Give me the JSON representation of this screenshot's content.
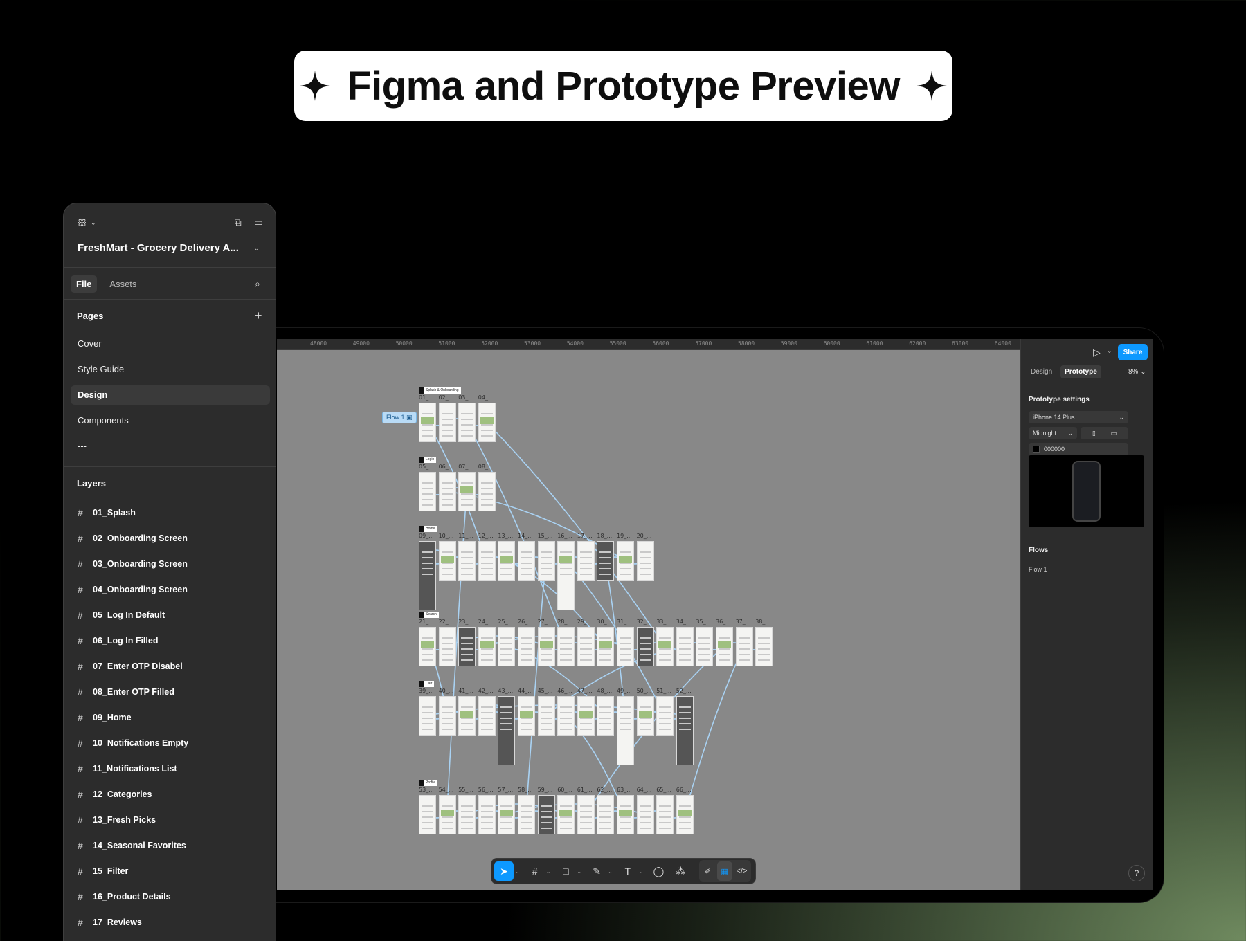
{
  "header": {
    "title": "Figma and Prototype Preview"
  },
  "left_panel": {
    "project_name": "FreshMart - Grocery Delivery A...",
    "tabs": [
      "File",
      "Assets"
    ],
    "pages_heading": "Pages",
    "pages": [
      "Cover",
      "Style Guide",
      "Design",
      "Components",
      "---"
    ],
    "active_page": "Design",
    "layers_heading": "Layers",
    "layers": [
      "01_Splash",
      "02_Onboarding Screen",
      "03_Onboarding Screen",
      "04_Onboarding Screen",
      "05_Log In Default",
      "06_Log In Filled",
      "07_Enter OTP Disabel",
      "08_Enter OTP Filled",
      "09_Home",
      "10_Notifications Empty",
      "11_Notifications List",
      "12_Categories",
      "13_Fresh Picks",
      "14_Seasonal Favorites",
      "15_Filter",
      "16_Product Details",
      "17_Reviews"
    ]
  },
  "ruler": {
    "ticks": [
      "48000",
      "49000",
      "50000",
      "51000",
      "52000",
      "53000",
      "54000",
      "55000",
      "56000",
      "57000",
      "58000",
      "59000",
      "60000",
      "61000",
      "62000",
      "63000",
      "64000"
    ]
  },
  "canvas": {
    "flow_tag": "Flow 1",
    "rows": [
      {
        "tag": "Splash & Onboarding",
        "labels": [
          "01_...",
          "02_...",
          "03_...",
          "04_..."
        ]
      },
      {
        "tag": "Login",
        "labels": [
          "05_...",
          "06_...",
          "07_...",
          "08_..."
        ]
      },
      {
        "tag": "Home",
        "labels": [
          "09_...",
          "10_...",
          "11_...",
          "12_...",
          "13_...",
          "14_...",
          "15_...",
          "16_...",
          "17_...",
          "18_...",
          "19_...",
          "20_..."
        ]
      },
      {
        "tag": "Search",
        "labels": [
          "21_...",
          "22_...",
          "23_...",
          "24_...",
          "25_...",
          "26_...",
          "27_...",
          "28_...",
          "29_...",
          "30_...",
          "31_...",
          "32_...",
          "33_...",
          "34_...",
          "35_...",
          "36_...",
          "37_...",
          "38_..."
        ]
      },
      {
        "tag": "Cart",
        "labels": [
          "39_...",
          "40_...",
          "41_...",
          "42_...",
          "43_...",
          "44_...",
          "45_...",
          "46_...",
          "47_...",
          "48_...",
          "49_...",
          "50_...",
          "51_...",
          "52_..."
        ]
      },
      {
        "tag": "Profile",
        "labels": [
          "53_...",
          "54_...",
          "55_...",
          "56_...",
          "57_...",
          "58_...",
          "59_...",
          "60_...",
          "61_...",
          "62_...",
          "63_...",
          "64_...",
          "65_...",
          "66_..."
        ]
      }
    ]
  },
  "right_panel": {
    "share_label": "Share",
    "tabs": [
      "Design",
      "Prototype"
    ],
    "active_tab": "Prototype",
    "zoom": "8%",
    "prototype_settings_heading": "Prototype settings",
    "device": "iPhone 14 Plus",
    "device_color": "Midnight",
    "background_color": "000000",
    "flows_heading": "Flows",
    "flows": [
      "Flow 1"
    ],
    "help": "?"
  },
  "colors": {
    "accent": "#0d99ff",
    "canvas": "#888888",
    "panel": "#2c2c2c",
    "link": "#a9d2f3"
  }
}
